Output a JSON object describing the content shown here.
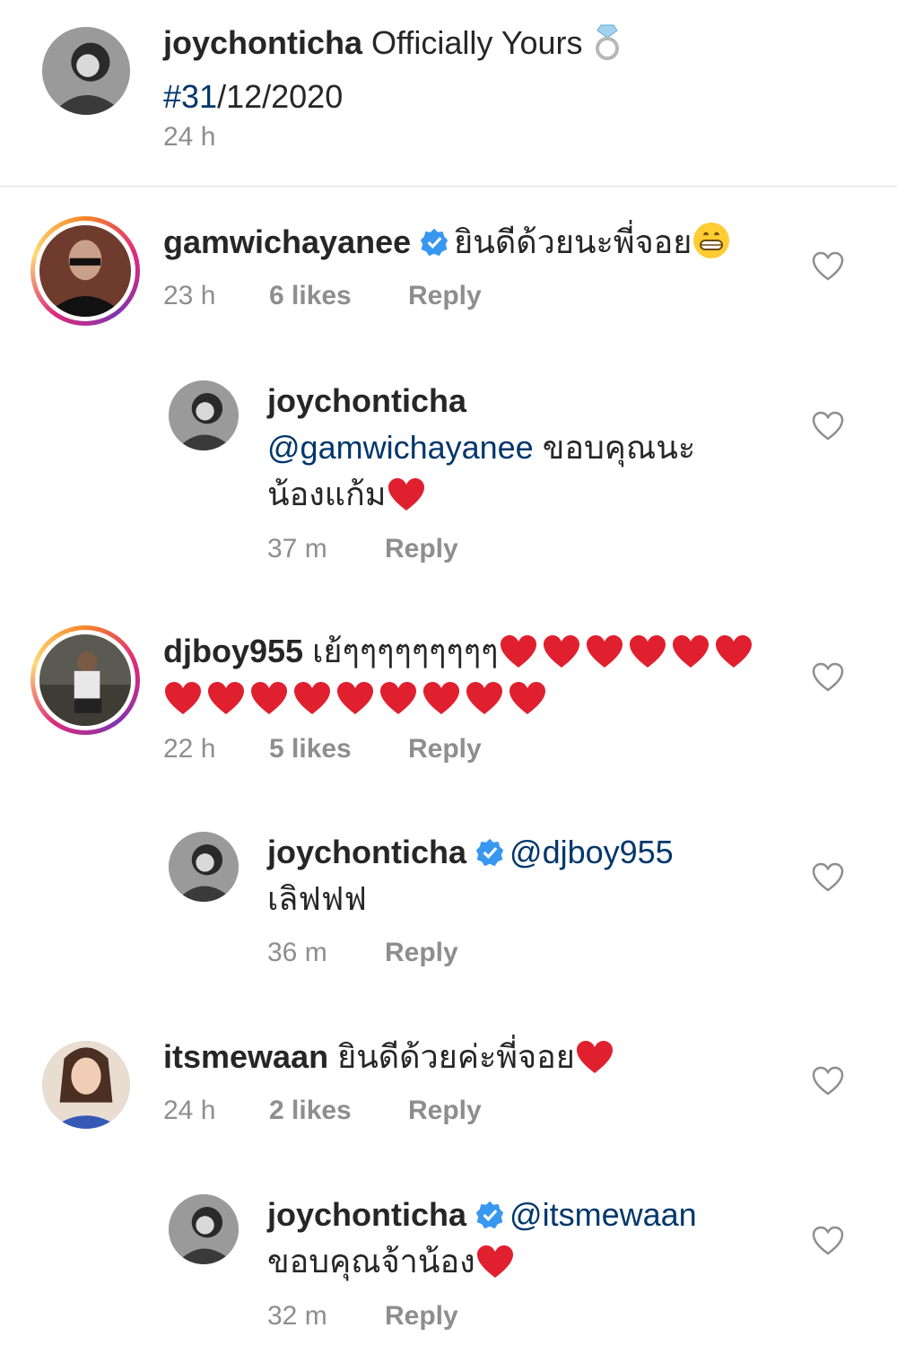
{
  "caption": {
    "username": "joychonticha",
    "text": "Officially Yours",
    "hashtag": "#31",
    "date_rest": "/12/2020",
    "time": "24 h",
    "ring_icon": "ring-emoji"
  },
  "comments": [
    {
      "username": "gamwichayanee",
      "verified": true,
      "text": "ยินดีด้วยนะพี่จอย",
      "emoji": "grinning-face",
      "time": "23 h",
      "likes": "6 likes",
      "reply": "Reply"
    },
    {
      "username": "joychonticha",
      "mention": "@gamwichayanee",
      "text_line1": "ขอบคุณนะ",
      "text_line2": "น้องแก้ม",
      "time": "37 m",
      "reply": "Reply"
    },
    {
      "username": "djboy955",
      "text": "เย้ๆๆๆๆๆๆๆๆๆ",
      "hearts_line1": 6,
      "hearts_line2": 9,
      "time": "22 h",
      "likes": "5 likes",
      "reply": "Reply"
    },
    {
      "username": "joychonticha",
      "verified": true,
      "mention": "@djboy955",
      "text": "เลิฟฟฟ",
      "time": "36 m",
      "reply": "Reply"
    },
    {
      "username": "itsmewaan",
      "text": "ยินดีด้วยค่ะพี่จอย",
      "time": "24 h",
      "likes": "2 likes",
      "reply": "Reply"
    },
    {
      "username": "joychonticha",
      "verified": true,
      "mention": "@itsmewaan",
      "text": "ขอบคุณจ้าน้อง",
      "time": "32 m",
      "reply": "Reply"
    }
  ],
  "colors": {
    "text": "#262626",
    "meta": "#8e8e8e",
    "link": "#00376b",
    "verified": "#3897f0",
    "heart": "#e0202f"
  }
}
